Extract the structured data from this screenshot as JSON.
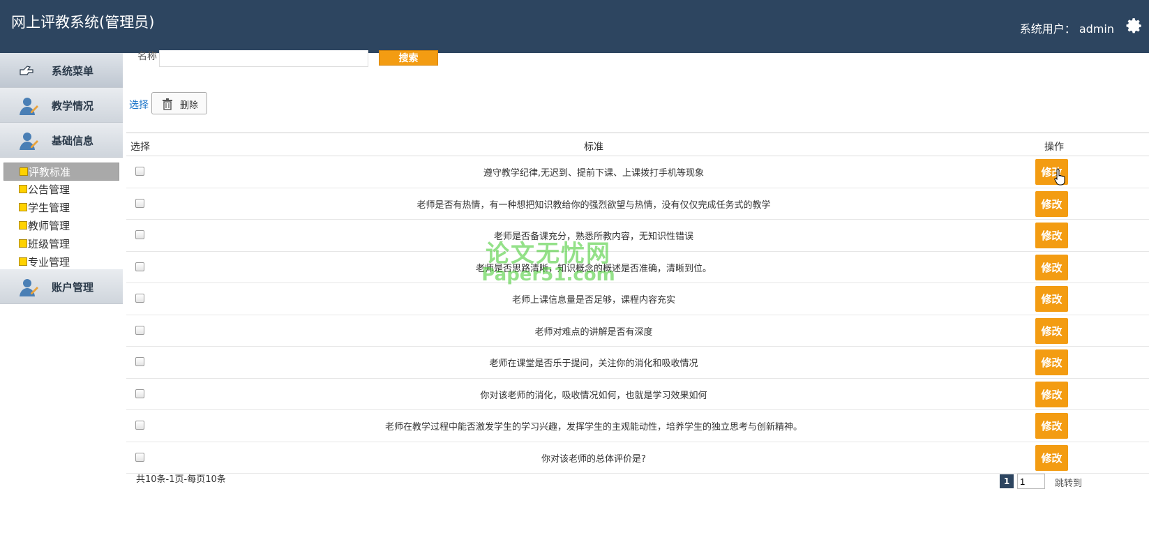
{
  "header": {
    "title": "网上评教系统(管理员)",
    "user_label": "系统用户：",
    "username": "admin"
  },
  "sidebar": {
    "menu_title": "系统菜单",
    "groups": [
      {
        "label": "教学情况"
      },
      {
        "label": "基础信息"
      },
      {
        "label": "账户管理"
      }
    ],
    "subitems": [
      {
        "label": "评教标准",
        "active": true
      },
      {
        "label": "公告管理"
      },
      {
        "label": "学生管理"
      },
      {
        "label": "教师管理"
      },
      {
        "label": "班级管理"
      },
      {
        "label": "专业管理"
      }
    ]
  },
  "search": {
    "name_label": "名称",
    "name_value": "",
    "button_label": "搜索"
  },
  "toolbar": {
    "select_label": "选择",
    "delete_label": "删除"
  },
  "table": {
    "columns": [
      "选择",
      "标准",
      "操作"
    ],
    "edit_label": "修改",
    "rows": [
      "遵守教学纪律,无迟到、提前下课、上课拨打手机等现象",
      "老师是否有热情，有一种想把知识教给你的强烈欲望与热情，没有仅仅完成任务式的教学",
      "老师是否备课充分，熟悉所教内容，无知识性错误",
      "老师是否思路清晰，知识概念的概述是否准确，清晰到位。",
      "老师上课信息量是否足够，课程内容充实",
      "老师对难点的讲解是否有深度",
      "老师在课堂是否乐于提问，关注你的消化和吸收情况",
      "你对该老师的消化，吸收情况如何，也就是学习效果如何",
      "老师在教学过程中能否激发学生的学习兴趣，发挥学生的主观能动性，培养学生的独立思考与创新精神。",
      "你对该老师的总体评价是?"
    ]
  },
  "pagination": {
    "summary": "共10条-1页-每页10条",
    "current_page": "1",
    "page_input": "1",
    "jump_label": "跳转到"
  },
  "watermark": {
    "line1": "论文无忧网",
    "line2": "Paper51.com"
  },
  "colors": {
    "header_bg": "#2d4560",
    "accent_orange": "#f39c12",
    "link_blue": "#1a73c8"
  }
}
